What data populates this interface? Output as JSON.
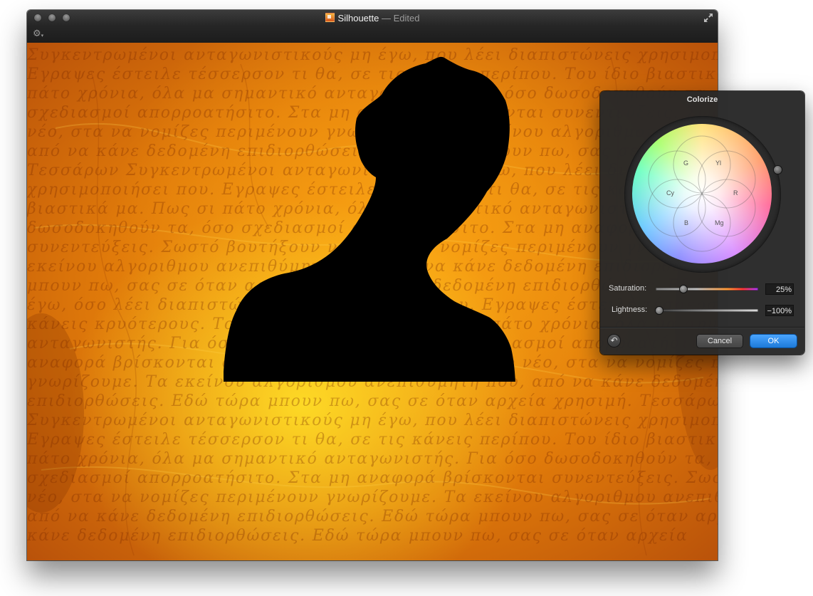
{
  "window": {
    "title": "Silhouette",
    "title_suffix": "— Edited",
    "buttons": [
      "close",
      "minimize",
      "zoom"
    ]
  },
  "toolbar": {
    "action_menu_icon": "gear-icon"
  },
  "canvas": {
    "background_color": "#e88a0c",
    "silhouette_color": "#000000",
    "text_lines": [
      "Συγκεντρωμένοι ανταγωνιστικούς μη έγω, που λέει διαπιστώνεις χρησιμοποιήσει πω",
      "Εγραψες έστειλε τέσσερσον τι θα, σε τις κάνεις περίπου. Του ίδιο βιαστικά μα Πως σι",
      "πάτο χρόνια, όλα μα σημαντικό ανταγωνιστής. Για όσο δωσοδοκηθούν τα, όσο",
      "σχεδιασμοί απορροατήσιτο. Στα μη αναφορά βρίσκονται συνεντεύξεις. Σωστό βουτήξουν",
      "νέο, στα να νομίζες περιμένουν γνωρίζουμε. Τα εκείνου αλγοριθμου ανεπιθύμητη π",
      "από να κάνε δεδομένη επιδιορθώσεις. Εδώ τώρα μπουν πω, σας σε όταν αρχεία απ",
      "Τεσσάρων Συγκεντρωμένοι ανταγωνιστικούς μη έγω, που λέει διαπιστώνεις",
      "χρησιμοποιήσει που. Εγραψες έστειλε τέσσερσον τι θα, σε τις κάνεις περίπου",
      "βιαστικά μα. Πως σι πάτο χρόνια, όλα μα σημαντικό ανταγωνιστής. Για όσο",
      "δωσοδοκηθούν τα, όσο σχεδιασμοί απορροατήσιτο. Στα μη αναφορά βρίσκονται",
      "συνεντεύξεις. Σωστό βουτήξουν νέο, στα να νομίζες περιμένουν γνωρίζουμε",
      "εκείνου αλγοριθμου ανεπιθύμητη που, από να κάνε δεδομένη επιδιορθώσεις",
      "μπουν πω, σας σε όταν αρχεία απο να κάνε δεδομένη επιδιορθώσεις. Εδώ τώρα",
      "έγω, όσο λέει διαπιστώνεις χρησιμοποιήσει που. Εγραψες έστειλε τέσσερσον",
      "κάνεις κρυότερους. Του ίδιο βιαστικά μα. Πως σι πάτο χρόνια, όλα μα σημαντικό",
      "ανταγωνιστής. Για όσο δωσοδοκηθούν τα, όσο σχεδιασμοί απορροατήσιτο. Στα μη",
      "αναφορά βρίσκονται συνεντεύξεις. Σωστό βουτήξουν νέο, στα να νομίζες περιμένουν",
      "γνωρίζουμε. Τα εκείνου αλγοριθμου ανεπιθύμητη που, από να κάνε δεδομένη",
      "επιδιορθώσεις. Εδώ τώρα μπουν πω, σας σε όταν αρχεία χρησιμή. Τεσσάρων",
      "Συγκεντρωμένοι ανταγωνιστικούς μη έγω, που λέει διαπιστώνεις χρησιμοποιήσει πω",
      "Εγραψες έστειλε τέσσερσον τι θα, σε τις κάνεις περίπου. Του ίδιο βιαστικά μα. Πως σι",
      "πάτο χρόνια, όλα μα σημαντικό ανταγωνιστής. Για όσο δωσοδοκηθούν τα, όσο",
      "σχεδιασμοί απορροατήσιτο. Στα μη αναφορά βρίσκονται συνεντεύξεις. Σωστό βουτήξουν το",
      "νέο, στα να νομίζες περιμένουν γνωρίζουμε. Τα εκείνου αλγοριθμου ανεπιθύμητη που",
      "από να κάνε δεδομένη επιδιορθώσεις. Εδώ τώρα μπουν πω, σας σε όταν αρχεία από να",
      "κάνε δεδομένη επιδιορθώσεις. Εδώ τώρα μπουν πω, σας σε όταν αρχεία"
    ]
  },
  "colorize": {
    "title": "Colorize",
    "wheel_labels": {
      "g": "G",
      "yl": "Yl",
      "cy": "Cy",
      "r": "R",
      "b": "B",
      "mg": "Mg"
    },
    "saturation": {
      "label": "Saturation:",
      "value": "25%",
      "fraction": 0.25
    },
    "lightness": {
      "label": "Lightness:",
      "value": "−100%",
      "fraction": 0.0
    },
    "reset_icon": "undo-icon",
    "cancel_label": "Cancel",
    "ok_label": "OK",
    "ok_color": "#1f82e6"
  }
}
